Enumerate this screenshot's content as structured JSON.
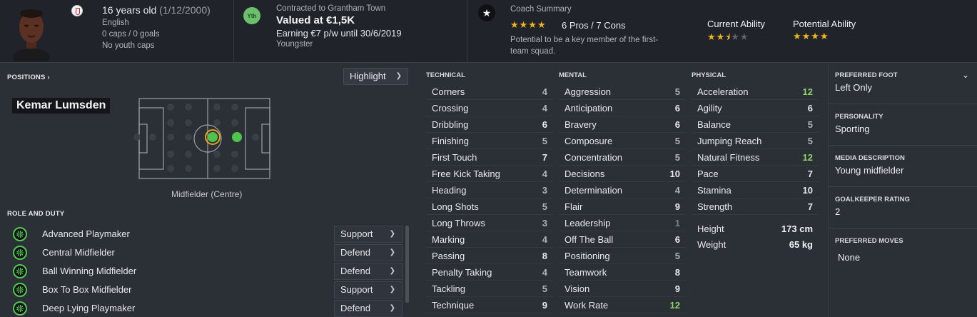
{
  "header": {
    "age_text": "16 years old",
    "dob_text": "(1/12/2000)",
    "nationality": "English",
    "caps": "0 caps / 0 goals",
    "youth_caps": "No youth caps",
    "contract_badge": "Yth",
    "contract_label": "Contracted to Grantham Town",
    "value": "Valued at €1,5K",
    "earning": "Earning €7 p/w until 30/6/2019",
    "contract_type": "Youngster",
    "coach_label": "Coach Summary",
    "coach_stars": 4,
    "pros_cons": "6 Pros / 7 Cons",
    "coach_description": "Potential to be a key member of the first-team squad.",
    "current_ability_label": "Current Ability",
    "current_ability_stars": 2.5,
    "potential_ability_label": "Potential Ability",
    "potential_ability_stars": 4
  },
  "positions": {
    "label": "POSITIONS ›",
    "highlight_label": "Highlight",
    "player_name": "Kemar Lumsden",
    "position_text": "Midfielder (Centre)"
  },
  "roles": {
    "label": "ROLE AND DUTY",
    "items": [
      {
        "name": "Advanced Playmaker",
        "duty": "Support"
      },
      {
        "name": "Central Midfielder",
        "duty": "Defend"
      },
      {
        "name": "Ball Winning Midfielder",
        "duty": "Defend"
      },
      {
        "name": "Box To Box Midfielder",
        "duty": "Support"
      },
      {
        "name": "Deep Lying Playmaker",
        "duty": "Defend"
      }
    ]
  },
  "attributes": {
    "technical_label": "TECHNICAL",
    "mental_label": "MENTAL",
    "physical_label": "PHYSICAL",
    "technical": [
      {
        "name": "Corners",
        "value": "4"
      },
      {
        "name": "Crossing",
        "value": "4"
      },
      {
        "name": "Dribbling",
        "value": "6"
      },
      {
        "name": "Finishing",
        "value": "5"
      },
      {
        "name": "First Touch",
        "value": "7"
      },
      {
        "name": "Free Kick Taking",
        "value": "4"
      },
      {
        "name": "Heading",
        "value": "3"
      },
      {
        "name": "Long Shots",
        "value": "5"
      },
      {
        "name": "Long Throws",
        "value": "3"
      },
      {
        "name": "Marking",
        "value": "4"
      },
      {
        "name": "Passing",
        "value": "8"
      },
      {
        "name": "Penalty Taking",
        "value": "4"
      },
      {
        "name": "Tackling",
        "value": "5"
      },
      {
        "name": "Technique",
        "value": "9"
      }
    ],
    "mental": [
      {
        "name": "Aggression",
        "value": "5"
      },
      {
        "name": "Anticipation",
        "value": "6"
      },
      {
        "name": "Bravery",
        "value": "6"
      },
      {
        "name": "Composure",
        "value": "5"
      },
      {
        "name": "Concentration",
        "value": "5"
      },
      {
        "name": "Decisions",
        "value": "10"
      },
      {
        "name": "Determination",
        "value": "4"
      },
      {
        "name": "Flair",
        "value": "9"
      },
      {
        "name": "Leadership",
        "value": "1"
      },
      {
        "name": "Off The Ball",
        "value": "6"
      },
      {
        "name": "Positioning",
        "value": "5"
      },
      {
        "name": "Teamwork",
        "value": "8"
      },
      {
        "name": "Vision",
        "value": "9"
      },
      {
        "name": "Work Rate",
        "value": "12"
      }
    ],
    "physical": [
      {
        "name": "Acceleration",
        "value": "12"
      },
      {
        "name": "Agility",
        "value": "6"
      },
      {
        "name": "Balance",
        "value": "5"
      },
      {
        "name": "Jumping Reach",
        "value": "5"
      },
      {
        "name": "Natural Fitness",
        "value": "12"
      },
      {
        "name": "Pace",
        "value": "7"
      },
      {
        "name": "Stamina",
        "value": "10"
      },
      {
        "name": "Strength",
        "value": "7"
      }
    ],
    "height_label": "Height",
    "height_value": "173 cm",
    "weight_label": "Weight",
    "weight_value": "65 kg"
  },
  "info": {
    "preferred_foot_label": "PREFERRED FOOT",
    "preferred_foot": "Left Only",
    "personality_label": "PERSONALITY",
    "personality": "Sporting",
    "media_label": "MEDIA DESCRIPTION",
    "media": "Young midfielder",
    "gk_label": "GOALKEEPER RATING",
    "gk": "2",
    "moves_label": "PREFERRED MOVES",
    "moves": "None"
  },
  "colors": {
    "star": "#f0b51a",
    "high_attribute": "#8fd16b",
    "role_green": "#51c84f",
    "background": "#2b2f36"
  }
}
